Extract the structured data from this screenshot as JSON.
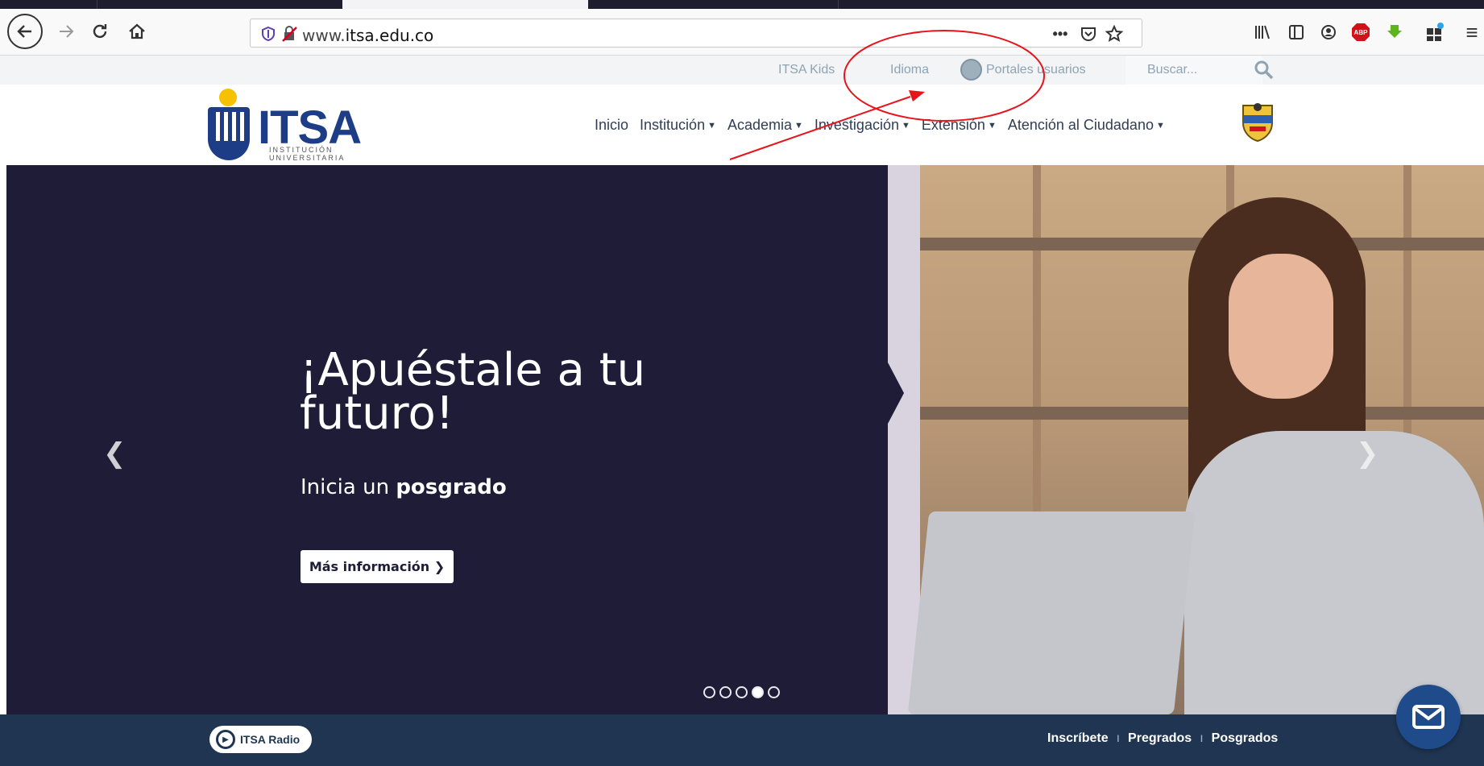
{
  "browser": {
    "url_prefix": "www.",
    "url_domain": "itsa.edu.co",
    "page_actions_icon": "•••",
    "pocket_icon": "pocket-icon",
    "bookmark_icon": "star-icon"
  },
  "utility_bar": {
    "kids": "ITSA Kids",
    "language": "Idioma",
    "portals": "Portales usuarios",
    "search_placeholder": "Buscar..."
  },
  "logo": {
    "wordmark": "ITSA",
    "sub1": "INSTITUCIÓN",
    "sub2": "UNIVERSITARIA"
  },
  "nav": {
    "items": [
      {
        "label": "Inicio",
        "dropdown": false
      },
      {
        "label": "Institución",
        "dropdown": true
      },
      {
        "label": "Academia",
        "dropdown": true
      },
      {
        "label": "Investigación",
        "dropdown": true
      },
      {
        "label": "Extensión",
        "dropdown": true
      },
      {
        "label": "Atención al Ciudadano",
        "dropdown": true
      }
    ],
    "caret": "▼"
  },
  "hero": {
    "headline": "¡Apuéstale a tu futuro!",
    "sub_prefix": "Inicia un ",
    "sub_bold": "posgrado",
    "cta": "Más información ❯",
    "slides_total": 5,
    "active_slide": 4,
    "prev_arrow": "❮",
    "next_arrow": "❯"
  },
  "bottom": {
    "radio": "ITSA Radio",
    "links": [
      "Inscríbete",
      "Pregrados",
      "Posgrados"
    ],
    "separator": "ı"
  },
  "colors": {
    "hero_bg": "#1e1c36",
    "brand_blue": "#1d3d86",
    "bottom_bar": "#1f3552",
    "annotation": "#e8141b"
  }
}
